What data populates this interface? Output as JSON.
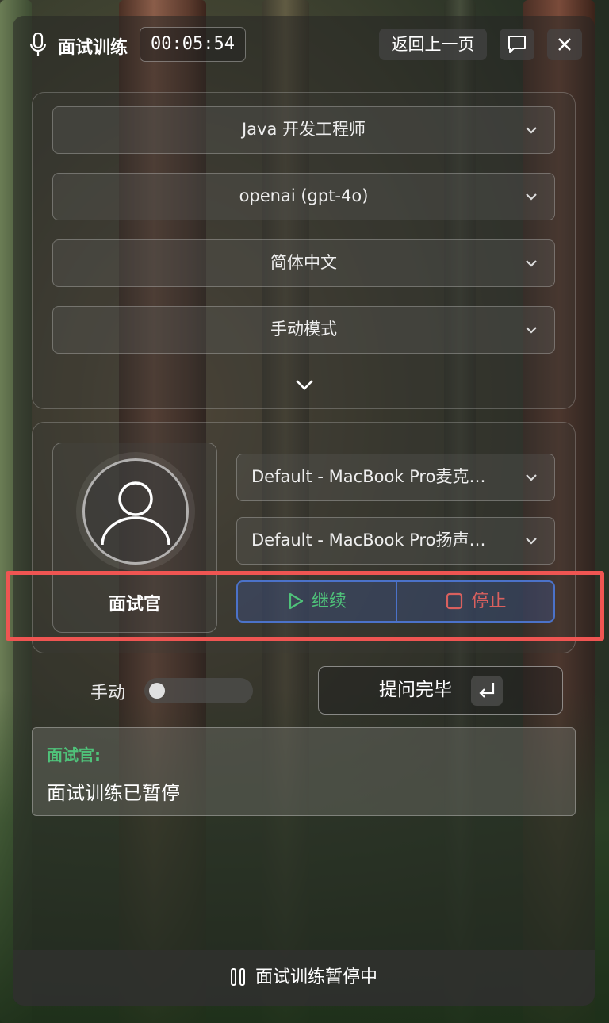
{
  "header": {
    "title": "面试训练",
    "timer": "00:05:54",
    "back_label": "返回上一页"
  },
  "config": {
    "role": "Java 开发工程师",
    "model": "openai (gpt-4o)",
    "language": "简体中文",
    "mode": "手动模式"
  },
  "interviewer": {
    "label": "面试官",
    "microphone": "Default - MacBook Pro麦克…",
    "speaker": "Default - MacBook Pro扬声…",
    "continue_label": "继续",
    "stop_label": "停止"
  },
  "manual": {
    "label": "手动",
    "toggle_on": false,
    "submit_label": "提问完毕"
  },
  "message": {
    "speaker": "面试官:",
    "text": "面试训练已暂停"
  },
  "footer": {
    "status": "面试训练暂停中"
  },
  "colors": {
    "accent_green": "#4fc37a",
    "accent_red": "#d9605e",
    "accent_blue": "#4b72c9",
    "highlight": "#ef5552"
  }
}
